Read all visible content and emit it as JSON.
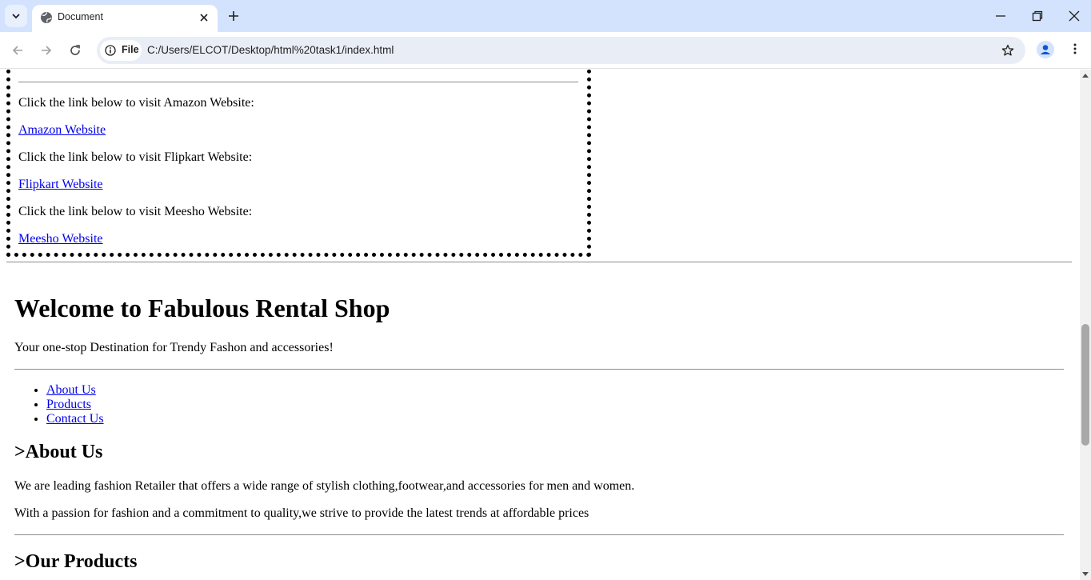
{
  "browser": {
    "tab_title": "Document",
    "site_chip_label": "File",
    "url": "C:/Users/ELCOT/Desktop/html%20task1/index.html"
  },
  "links_box": {
    "items": [
      {
        "text": "Click the link below to visit Amazon Website:",
        "link": "Amazon Website"
      },
      {
        "text": "Click the link below to visit Flipkart Website:",
        "link": "Flipkart Website"
      },
      {
        "text": "Click the link below to visit Meesho Website:",
        "link": "Meesho Website"
      }
    ]
  },
  "page": {
    "heading": "Welcome to Fabulous Rental Shop",
    "tagline": "Your one-stop Destination for Trendy Fashon and accessories!",
    "nav": [
      "About Us",
      "Products",
      "Contact Us"
    ],
    "about": {
      "heading": ">About Us",
      "paragraphs": [
        "We are leading fashion Retailer that offers a wide range of stylish clothing,footwear,and accessories for men and women.",
        "With a passion for fashion and a commitment to quality,we strive to provide the latest trends at affordable prices"
      ]
    },
    "products": {
      "heading": ">Our Products"
    }
  }
}
